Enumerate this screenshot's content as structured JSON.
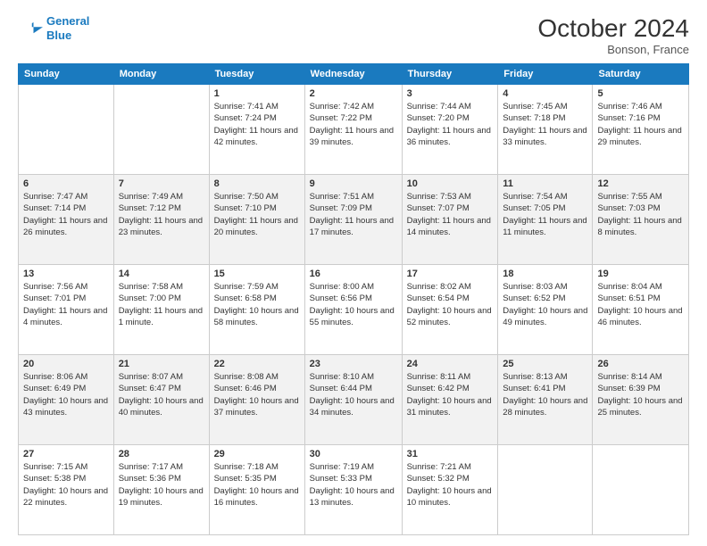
{
  "header": {
    "logo_line1": "General",
    "logo_line2": "Blue",
    "month": "October 2024",
    "location": "Bonson, France"
  },
  "days_of_week": [
    "Sunday",
    "Monday",
    "Tuesday",
    "Wednesday",
    "Thursday",
    "Friday",
    "Saturday"
  ],
  "weeks": [
    [
      {
        "date": "",
        "sunrise": "",
        "sunset": "",
        "daylight": ""
      },
      {
        "date": "",
        "sunrise": "",
        "sunset": "",
        "daylight": ""
      },
      {
        "date": "1",
        "sunrise": "Sunrise: 7:41 AM",
        "sunset": "Sunset: 7:24 PM",
        "daylight": "Daylight: 11 hours and 42 minutes."
      },
      {
        "date": "2",
        "sunrise": "Sunrise: 7:42 AM",
        "sunset": "Sunset: 7:22 PM",
        "daylight": "Daylight: 11 hours and 39 minutes."
      },
      {
        "date": "3",
        "sunrise": "Sunrise: 7:44 AM",
        "sunset": "Sunset: 7:20 PM",
        "daylight": "Daylight: 11 hours and 36 minutes."
      },
      {
        "date": "4",
        "sunrise": "Sunrise: 7:45 AM",
        "sunset": "Sunset: 7:18 PM",
        "daylight": "Daylight: 11 hours and 33 minutes."
      },
      {
        "date": "5",
        "sunrise": "Sunrise: 7:46 AM",
        "sunset": "Sunset: 7:16 PM",
        "daylight": "Daylight: 11 hours and 29 minutes."
      }
    ],
    [
      {
        "date": "6",
        "sunrise": "Sunrise: 7:47 AM",
        "sunset": "Sunset: 7:14 PM",
        "daylight": "Daylight: 11 hours and 26 minutes."
      },
      {
        "date": "7",
        "sunrise": "Sunrise: 7:49 AM",
        "sunset": "Sunset: 7:12 PM",
        "daylight": "Daylight: 11 hours and 23 minutes."
      },
      {
        "date": "8",
        "sunrise": "Sunrise: 7:50 AM",
        "sunset": "Sunset: 7:10 PM",
        "daylight": "Daylight: 11 hours and 20 minutes."
      },
      {
        "date": "9",
        "sunrise": "Sunrise: 7:51 AM",
        "sunset": "Sunset: 7:09 PM",
        "daylight": "Daylight: 11 hours and 17 minutes."
      },
      {
        "date": "10",
        "sunrise": "Sunrise: 7:53 AM",
        "sunset": "Sunset: 7:07 PM",
        "daylight": "Daylight: 11 hours and 14 minutes."
      },
      {
        "date": "11",
        "sunrise": "Sunrise: 7:54 AM",
        "sunset": "Sunset: 7:05 PM",
        "daylight": "Daylight: 11 hours and 11 minutes."
      },
      {
        "date": "12",
        "sunrise": "Sunrise: 7:55 AM",
        "sunset": "Sunset: 7:03 PM",
        "daylight": "Daylight: 11 hours and 8 minutes."
      }
    ],
    [
      {
        "date": "13",
        "sunrise": "Sunrise: 7:56 AM",
        "sunset": "Sunset: 7:01 PM",
        "daylight": "Daylight: 11 hours and 4 minutes."
      },
      {
        "date": "14",
        "sunrise": "Sunrise: 7:58 AM",
        "sunset": "Sunset: 7:00 PM",
        "daylight": "Daylight: 11 hours and 1 minute."
      },
      {
        "date": "15",
        "sunrise": "Sunrise: 7:59 AM",
        "sunset": "Sunset: 6:58 PM",
        "daylight": "Daylight: 10 hours and 58 minutes."
      },
      {
        "date": "16",
        "sunrise": "Sunrise: 8:00 AM",
        "sunset": "Sunset: 6:56 PM",
        "daylight": "Daylight: 10 hours and 55 minutes."
      },
      {
        "date": "17",
        "sunrise": "Sunrise: 8:02 AM",
        "sunset": "Sunset: 6:54 PM",
        "daylight": "Daylight: 10 hours and 52 minutes."
      },
      {
        "date": "18",
        "sunrise": "Sunrise: 8:03 AM",
        "sunset": "Sunset: 6:52 PM",
        "daylight": "Daylight: 10 hours and 49 minutes."
      },
      {
        "date": "19",
        "sunrise": "Sunrise: 8:04 AM",
        "sunset": "Sunset: 6:51 PM",
        "daylight": "Daylight: 10 hours and 46 minutes."
      }
    ],
    [
      {
        "date": "20",
        "sunrise": "Sunrise: 8:06 AM",
        "sunset": "Sunset: 6:49 PM",
        "daylight": "Daylight: 10 hours and 43 minutes."
      },
      {
        "date": "21",
        "sunrise": "Sunrise: 8:07 AM",
        "sunset": "Sunset: 6:47 PM",
        "daylight": "Daylight: 10 hours and 40 minutes."
      },
      {
        "date": "22",
        "sunrise": "Sunrise: 8:08 AM",
        "sunset": "Sunset: 6:46 PM",
        "daylight": "Daylight: 10 hours and 37 minutes."
      },
      {
        "date": "23",
        "sunrise": "Sunrise: 8:10 AM",
        "sunset": "Sunset: 6:44 PM",
        "daylight": "Daylight: 10 hours and 34 minutes."
      },
      {
        "date": "24",
        "sunrise": "Sunrise: 8:11 AM",
        "sunset": "Sunset: 6:42 PM",
        "daylight": "Daylight: 10 hours and 31 minutes."
      },
      {
        "date": "25",
        "sunrise": "Sunrise: 8:13 AM",
        "sunset": "Sunset: 6:41 PM",
        "daylight": "Daylight: 10 hours and 28 minutes."
      },
      {
        "date": "26",
        "sunrise": "Sunrise: 8:14 AM",
        "sunset": "Sunset: 6:39 PM",
        "daylight": "Daylight: 10 hours and 25 minutes."
      }
    ],
    [
      {
        "date": "27",
        "sunrise": "Sunrise: 7:15 AM",
        "sunset": "Sunset: 5:38 PM",
        "daylight": "Daylight: 10 hours and 22 minutes."
      },
      {
        "date": "28",
        "sunrise": "Sunrise: 7:17 AM",
        "sunset": "Sunset: 5:36 PM",
        "daylight": "Daylight: 10 hours and 19 minutes."
      },
      {
        "date": "29",
        "sunrise": "Sunrise: 7:18 AM",
        "sunset": "Sunset: 5:35 PM",
        "daylight": "Daylight: 10 hours and 16 minutes."
      },
      {
        "date": "30",
        "sunrise": "Sunrise: 7:19 AM",
        "sunset": "Sunset: 5:33 PM",
        "daylight": "Daylight: 10 hours and 13 minutes."
      },
      {
        "date": "31",
        "sunrise": "Sunrise: 7:21 AM",
        "sunset": "Sunset: 5:32 PM",
        "daylight": "Daylight: 10 hours and 10 minutes."
      },
      {
        "date": "",
        "sunrise": "",
        "sunset": "",
        "daylight": ""
      },
      {
        "date": "",
        "sunrise": "",
        "sunset": "",
        "daylight": ""
      }
    ]
  ]
}
